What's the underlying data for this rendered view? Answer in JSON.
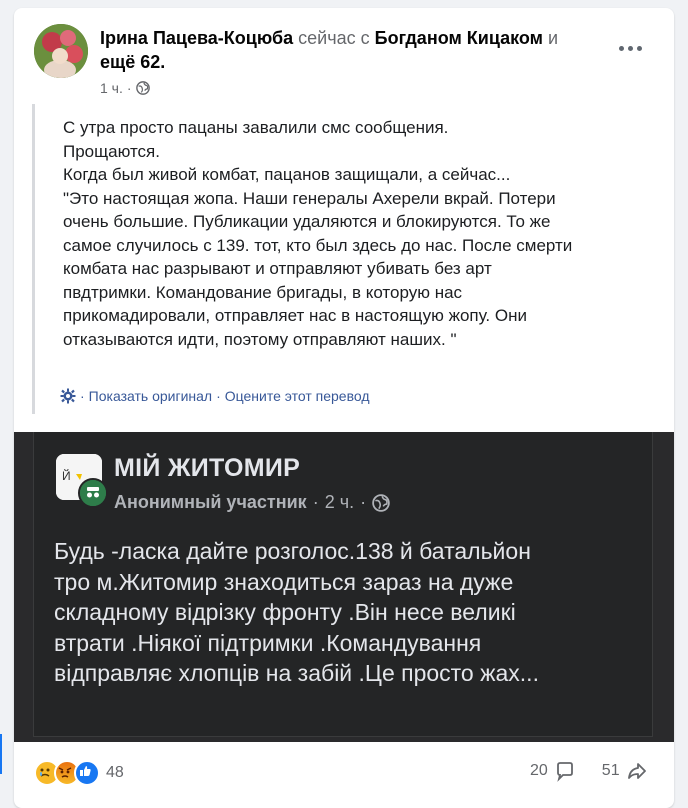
{
  "post": {
    "author": "Ірина Пацева-Коцюба",
    "when_inline": "сейчас",
    "with_word": "с",
    "tagged": "Богданом Кицаком",
    "and_word": "и",
    "others": "ещё 62",
    "period": ".",
    "time": "1 ч.",
    "dot": "·",
    "privacy_icon": "globe-icon"
  },
  "quote": {
    "lines": [
      "С утра просто пацаны завалили смс сообщения.",
      "Прощаются.",
      "Когда был живой комбат, пацанов защищали, а сейчас...",
      "\"Это настоящая жопа. Наши генералы Ахерели вкрай. Потери",
      "очень большие. Публикации удаляются и блокируются. То же",
      "самое случилось с 139. тот, кто был здесь до нас. После смерти",
      "комбата нас разрывают и отправляют убивать без арт",
      "пвдтримки. Командование бригады, в которую нас",
      "прикомадировали, отправляет нас в настоящую жопу. Они",
      "отказываются идти, поэтому отправляют наших. \""
    ]
  },
  "translation": {
    "show_original": "Показать оригинал",
    "sep": "·",
    "rate": "Оцените этот перевод"
  },
  "shared": {
    "group_name": "МІЙ ЖИТОМИР",
    "member": "Анонимный участник",
    "dot": "·",
    "time": "2 ч.",
    "lines": [
      "Будь -ласка дайте розголос.138 й батальйон",
      "тро м.Житомир знаходиться зараз на дуже",
      "складному відрізку фронту .Він несе великі",
      "втрати .Ніякої підтримки .Командування",
      "відправляє хлопців на забій .Це просто жах..."
    ]
  },
  "footer": {
    "reaction_count": "48",
    "comments": "20",
    "shares": "51"
  },
  "colors": {
    "accent": "#1877f2",
    "link": "#385898",
    "dark_bg": "#242526"
  }
}
